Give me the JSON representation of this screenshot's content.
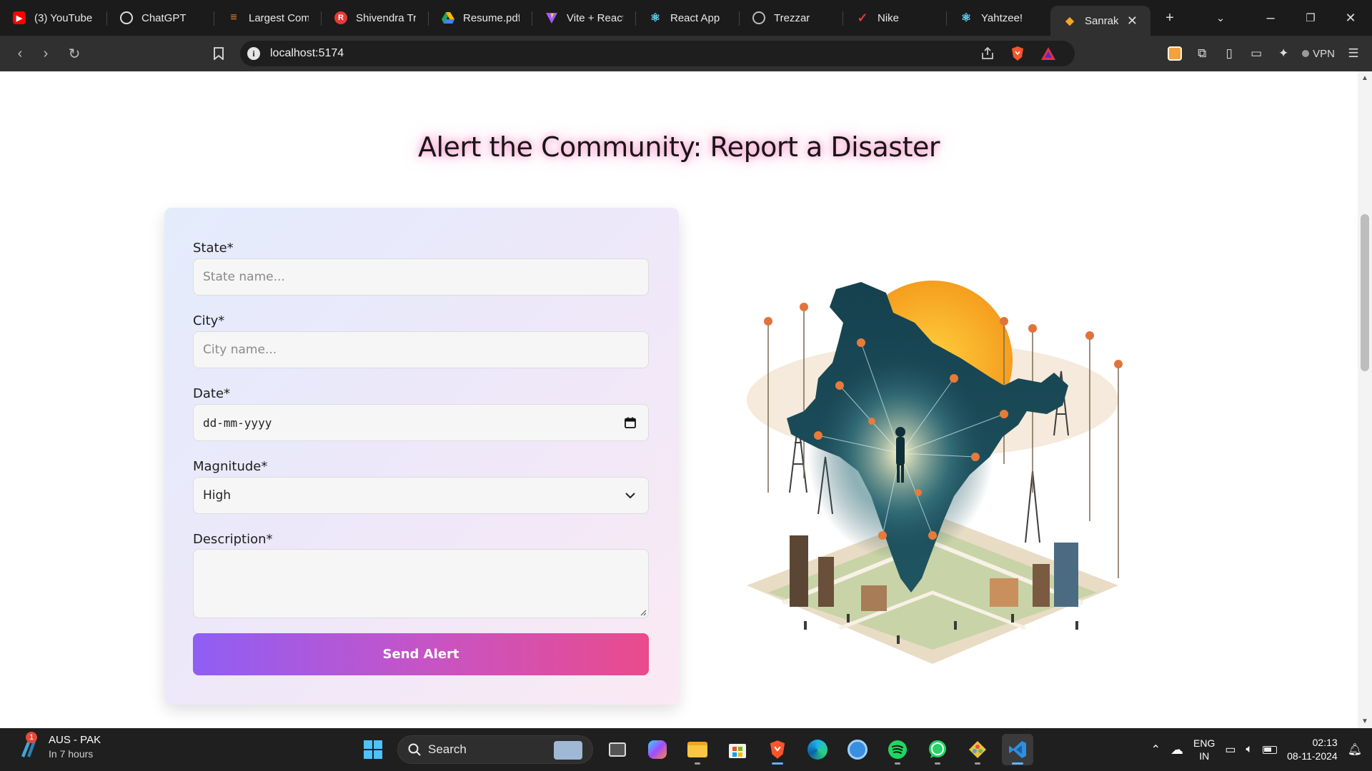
{
  "browser": {
    "tabs": [
      {
        "label": "(3) YouTube",
        "icon": "youtube-icon",
        "color": "#ff0000"
      },
      {
        "label": "ChatGPT",
        "icon": "chatgpt-icon",
        "color": "#444444"
      },
      {
        "label": "Largest Comi",
        "icon": "stack-icon",
        "color": "#f48024"
      },
      {
        "label": "Shivendra Tri",
        "icon": "resume-icon",
        "color": "#e53935"
      },
      {
        "label": "Resume.pdf",
        "icon": "google-drive-icon",
        "color": "#1fa463"
      },
      {
        "label": "Vite + React",
        "icon": "vite-icon",
        "color": "#a259ff"
      },
      {
        "label": "React App",
        "icon": "react-icon",
        "color": "#61dafb"
      },
      {
        "label": "Trezzar",
        "icon": "globe-icon",
        "color": "#888888"
      },
      {
        "label": "Nike",
        "icon": "nike-icon",
        "color": "#e53935"
      },
      {
        "label": "Yahtzee!",
        "icon": "react-icon",
        "color": "#61dafb"
      },
      {
        "label": "Sanraksh",
        "icon": "sanrakshak-icon",
        "color": "#f5a623",
        "active": true
      }
    ],
    "url": "localhost:5174",
    "vpn_label": "VPN"
  },
  "page": {
    "title": "Alert the Community: Report a Disaster",
    "form": {
      "state_label": "State*",
      "state_placeholder": "State name...",
      "city_label": "City*",
      "city_placeholder": "City name...",
      "date_label": "Date*",
      "date_placeholder": "dd-mm-yyyy",
      "magnitude_label": "Magnitude*",
      "magnitude_value": "High",
      "description_label": "Description*",
      "submit_label": "Send Alert"
    },
    "illustration_icon": "india-map-network-illustration",
    "accent_gradient": [
      "#8f5ef5",
      "#ea4b8c"
    ]
  },
  "taskbar": {
    "weather_title": "AUS - PAK",
    "weather_sub": "In 7 hours",
    "weather_badge": "1",
    "search_label": "Search",
    "lang_top": "ENG",
    "lang_bottom": "IN",
    "time": "02:13",
    "date": "08-11-2024"
  }
}
